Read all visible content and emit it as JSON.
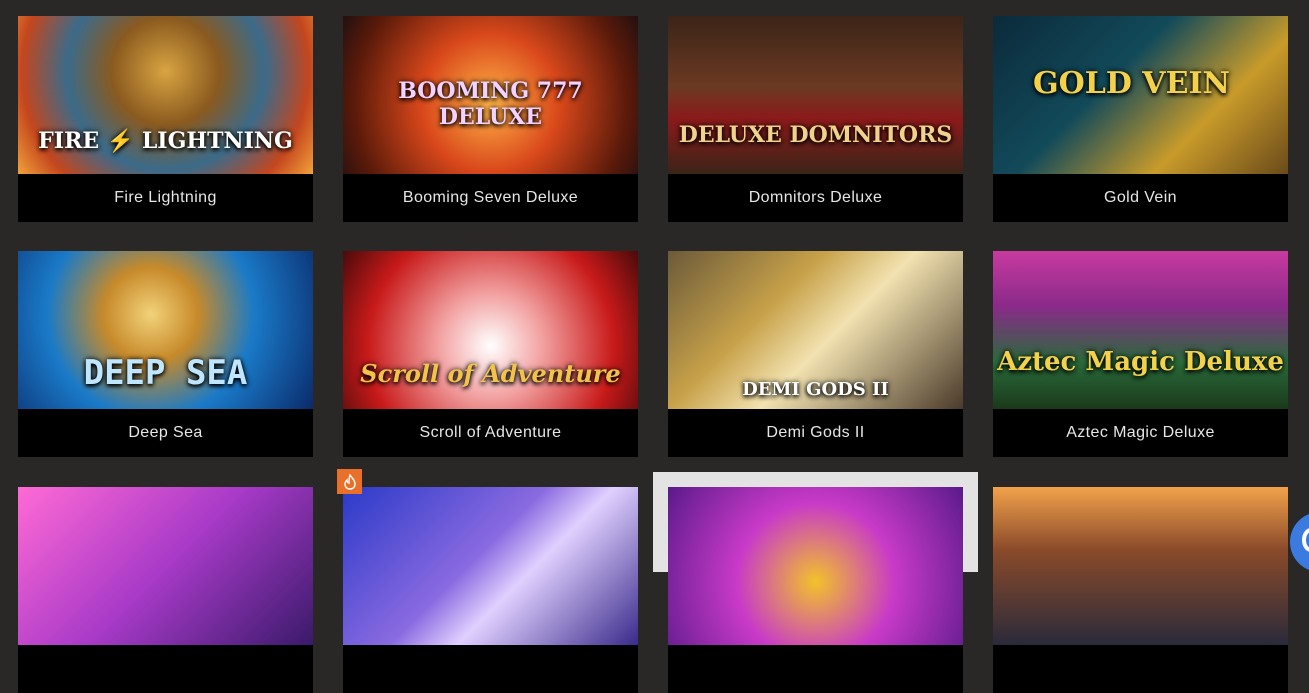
{
  "games": [
    {
      "title": "Fire Lightning",
      "art_text": "FIRE ⚡ LIGHTNING"
    },
    {
      "title": "Booming Seven Deluxe",
      "art_text": "BOOMING 777 DELUXE"
    },
    {
      "title": "Domnitors Deluxe",
      "art_text": "DELUXE DOMNITORS"
    },
    {
      "title": "Gold Vein",
      "art_text": "GOLD VEIN"
    },
    {
      "title": "Deep Sea",
      "art_text": "DEEP SEA"
    },
    {
      "title": "Scroll of Adventure",
      "art_text": "Scroll of Adventure"
    },
    {
      "title": "Demi Gods II",
      "art_text": "DEMI GODS II"
    },
    {
      "title": "Aztec Magic Deluxe",
      "art_text": "Aztec Magic Deluxe"
    },
    {
      "title": "",
      "art_text": ""
    },
    {
      "title": "",
      "art_text": ""
    },
    {
      "title": "",
      "art_text": ""
    },
    {
      "title": "",
      "art_text": ""
    }
  ],
  "badge_icon": "hot-flame-icon",
  "chat_button_icon": "chat-icon",
  "colors": {
    "background": "#2a2727",
    "caption_bg": "#000000",
    "caption_text": "#e6e6e6",
    "badge": "#e8702a",
    "chat_button": "#3b7be0",
    "hover_highlight": "#e3e3e3"
  }
}
